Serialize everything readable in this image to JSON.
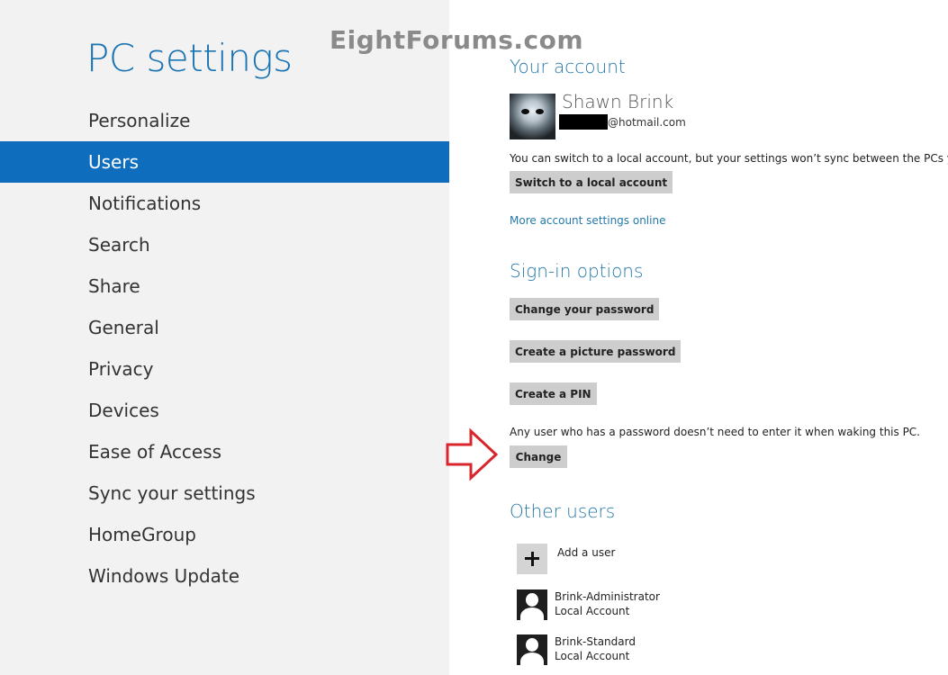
{
  "watermark": "EightForums.com",
  "sidebar": {
    "title": "PC settings",
    "items": [
      {
        "label": "Personalize"
      },
      {
        "label": "Users",
        "selected": true
      },
      {
        "label": "Notifications"
      },
      {
        "label": "Search"
      },
      {
        "label": "Share"
      },
      {
        "label": "General"
      },
      {
        "label": "Privacy"
      },
      {
        "label": "Devices"
      },
      {
        "label": "Ease of Access"
      },
      {
        "label": "Sync your settings"
      },
      {
        "label": "HomeGroup"
      },
      {
        "label": "Windows Update"
      }
    ]
  },
  "account": {
    "heading": "Your account",
    "name": "Shawn Brink",
    "email_domain": "@hotmail.com",
    "switch_info": "You can switch to a local account, but your settings won’t sync between the PCs you use.",
    "switch_button": "Switch to a local account",
    "more_settings_link": "More account settings online"
  },
  "signin": {
    "heading": "Sign-in options",
    "change_password_button": "Change your password",
    "picture_password_button": "Create a picture password",
    "pin_button": "Create a PIN",
    "wake_info": "Any user who has a password doesn’t need to enter it when waking this PC.",
    "change_button": "Change"
  },
  "other_users": {
    "heading": "Other users",
    "add_user_label": "Add a user",
    "users": [
      {
        "name": "Brink-Administrator",
        "type": "Local Account"
      },
      {
        "name": "Brink-Standard",
        "type": "Local Account"
      }
    ]
  },
  "colors": {
    "accent": "#0f6dbd",
    "heading": "#2478a9",
    "arrow": "#d9262c",
    "sidebar_bg": "#f2f2f2"
  },
  "icons": {
    "arrow": "right-arrow-outline-icon",
    "add_user": "plus-icon",
    "user_tile": "user-silhouette-icon"
  }
}
